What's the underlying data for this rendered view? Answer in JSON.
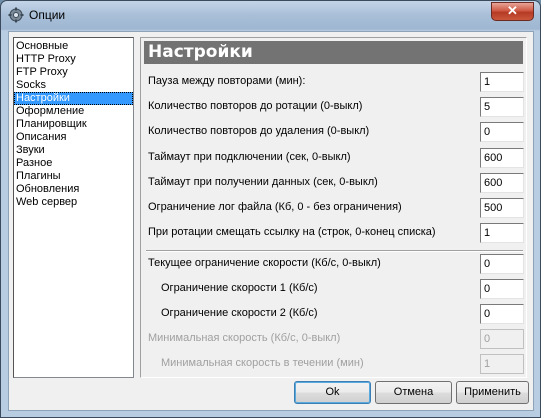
{
  "window": {
    "title": "Опции",
    "close_symbol": "✕"
  },
  "nav": {
    "items": [
      {
        "label": "Основные"
      },
      {
        "label": "HTTP Proxy"
      },
      {
        "label": "FTP Proxy"
      },
      {
        "label": "Socks"
      },
      {
        "label": "Настройки",
        "selected": true
      },
      {
        "label": "Оформление"
      },
      {
        "label": "Планировщик"
      },
      {
        "label": "Описания"
      },
      {
        "label": "Звуки"
      },
      {
        "label": "Разное"
      },
      {
        "label": "Плагины"
      },
      {
        "label": "Обновления"
      },
      {
        "label": "Web сервер"
      }
    ]
  },
  "panel": {
    "header": "Настройки",
    "settings": [
      {
        "label": "Пауза между повторами (мин):",
        "value": "1"
      },
      {
        "label": "Количество повторов до ротации (0-выкл)",
        "value": "5"
      },
      {
        "label": "Количество повторов до удаления (0-выкл)",
        "value": "0"
      },
      {
        "label": "Таймаут при подключении (сек, 0-выкл)",
        "value": "600"
      },
      {
        "label": "Таймаут при получении данных (сек, 0-выкл)",
        "value": "600"
      },
      {
        "label": "Ограничение лог файла (Кб, 0 - без ограничения)",
        "value": "500"
      },
      {
        "label": "При ротации смещать ссылку на (строк, 0-конец списка)",
        "value": "1"
      }
    ],
    "speed": [
      {
        "label": "Текущее ограничение скорости (Кб/с, 0-выкл)",
        "value": "0"
      },
      {
        "label": "Ограничение скорости 1 (Кб/с)",
        "value": "0",
        "indent": true
      },
      {
        "label": "Ограничение скорости 2 (Кб/с)",
        "value": "0",
        "indent": true
      },
      {
        "label": "Минимальная  скорость (Кб/с, 0-выкл)",
        "value": "0",
        "disabled": true
      },
      {
        "label": "Минимальная скорость в течении (мин)",
        "value": "1",
        "disabled": true,
        "indent": true
      }
    ]
  },
  "buttons": {
    "ok": "Ok",
    "cancel": "Отмена",
    "apply": "Применить"
  }
}
